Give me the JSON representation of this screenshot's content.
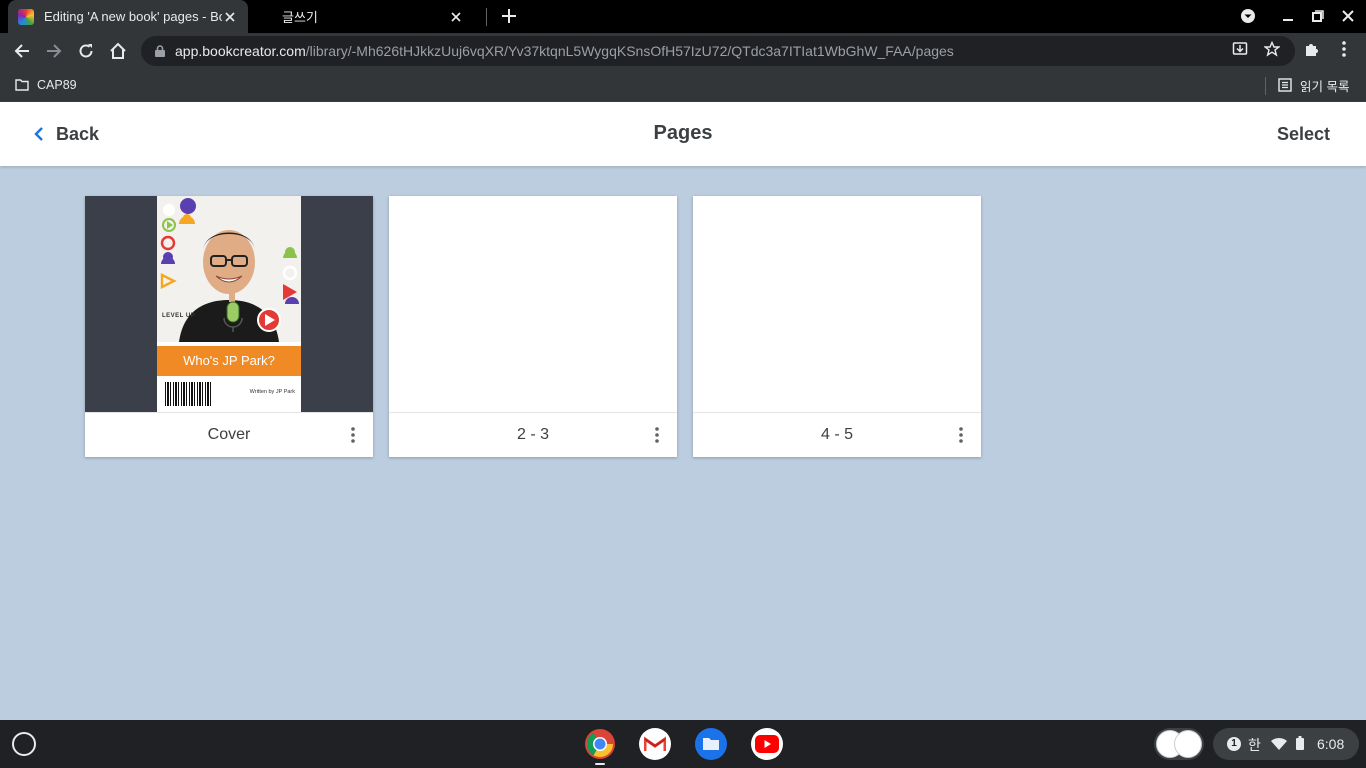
{
  "browser": {
    "tabs": [
      {
        "title": "Editing 'A new book' pages - Bo",
        "active": true
      },
      {
        "title": "글쓰기",
        "active": false
      }
    ],
    "url_host": "app.bookcreator.com",
    "url_path": "/library/-Mh626tHJkkzUuj6vqXR/Yv37ktqnL5WygqKSnsOfH57IzU72/QTdc3a7ITIat1WbGhW_FAA/pages",
    "bookmarks": [
      {
        "label": "CAP89"
      }
    ],
    "reading_list_label": "읽기 목록"
  },
  "app": {
    "back_label": "Back",
    "title": "Pages",
    "select_label": "Select"
  },
  "pages": [
    {
      "label": "Cover",
      "cover_title": "Who's JP Park?",
      "cover_byline": "Written by JP Park",
      "cover_badge": "LEVEL UP"
    },
    {
      "label": "2 - 3"
    },
    {
      "label": "4 - 5"
    }
  ],
  "system": {
    "notification_count": "1",
    "ime_label": "한",
    "time": "6:08"
  },
  "colors": {
    "background": "#bccde0",
    "accent_blue": "#1a73e8",
    "cover_band": "#f08a24"
  }
}
